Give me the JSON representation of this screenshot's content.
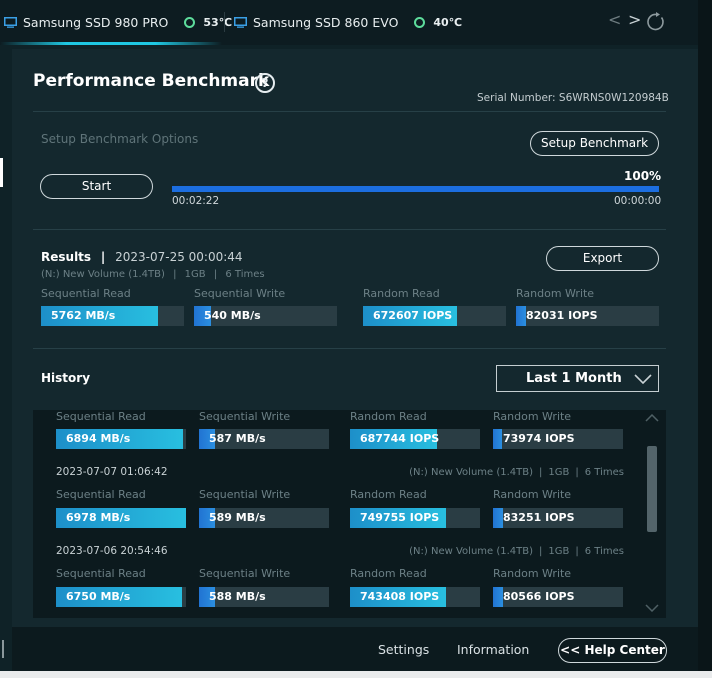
{
  "tabs": [
    {
      "name": "Samsung SSD 980 PRO",
      "temp": "53℃"
    },
    {
      "name": "Samsung SSD 860 EVO",
      "temp": "40℃"
    }
  ],
  "nav": {
    "prev": "<",
    "next": ">"
  },
  "title": "Performance Benchmark",
  "help_glyph": "?",
  "serial": "Serial Number: S6WRNS0W120984B",
  "setup": {
    "options_label": "Setup Benchmark Options",
    "button": "Setup Benchmark"
  },
  "run": {
    "start_button": "Start",
    "percent": "100%",
    "percent_value": 100,
    "elapsed": "00:02:22",
    "remaining": "00:00:00"
  },
  "results": {
    "label": "Results",
    "separator": "|",
    "datetime": "2023-07-25 00:00:44",
    "volume": "(N:) New Volume (1.4TB)",
    "size": "1GB",
    "times": "6 Times",
    "export_button": "Export",
    "metrics": [
      {
        "label": "Sequential Read",
        "value": "5762 MB/s",
        "fill": 0.82
      },
      {
        "label": "Sequential Write",
        "value": "540 MB/s",
        "fill": 0.12
      },
      {
        "label": "Random Read",
        "value": "672607 IOPS",
        "fill": 0.66
      },
      {
        "label": "Random Write",
        "value": "82031 IOPS",
        "fill": 0.07
      }
    ]
  },
  "history": {
    "label": "History",
    "filter": "Last 1 Month",
    "entries": [
      {
        "datetime": "",
        "volume": "",
        "size": "",
        "times": "",
        "metrics": [
          {
            "label": "Sequential Read",
            "value": "6894 MB/s",
            "fill": 0.98
          },
          {
            "label": "Sequential Write",
            "value": "587 MB/s",
            "fill": 0.12
          },
          {
            "label": "Random Read",
            "value": "687744 IOPS",
            "fill": 0.67
          },
          {
            "label": "Random Write",
            "value": "73974 IOPS",
            "fill": 0.07
          }
        ]
      },
      {
        "datetime": "2023-07-07 01:06:42",
        "volume": "(N:) New Volume (1.4TB)",
        "size": "1GB",
        "times": "6 Times",
        "metrics": [
          {
            "label": "Sequential Read",
            "value": "6978 MB/s",
            "fill": 1.0
          },
          {
            "label": "Sequential Write",
            "value": "589 MB/s",
            "fill": 0.12
          },
          {
            "label": "Random Read",
            "value": "749755 IOPS",
            "fill": 0.74
          },
          {
            "label": "Random Write",
            "value": "83251 IOPS",
            "fill": 0.08
          }
        ]
      },
      {
        "datetime": "2023-07-06 20:54:46",
        "volume": "(N:) New Volume (1.4TB)",
        "size": "1GB",
        "times": "6 Times",
        "metrics": [
          {
            "label": "Sequential Read",
            "value": "6750 MB/s",
            "fill": 0.97
          },
          {
            "label": "Sequential Write",
            "value": "588 MB/s",
            "fill": 0.12
          },
          {
            "label": "Random Read",
            "value": "743408 IOPS",
            "fill": 0.74
          },
          {
            "label": "Random Write",
            "value": "80566 IOPS",
            "fill": 0.08
          }
        ]
      }
    ]
  },
  "footer": {
    "settings": "Settings",
    "information": "Information",
    "help_center": "<< Help Center"
  },
  "colors": {
    "accent": "#1fc8e3",
    "bar_fill": "#28bfe0",
    "progress": "#1c6ee0",
    "temp_ok": "#5ddc9c"
  }
}
